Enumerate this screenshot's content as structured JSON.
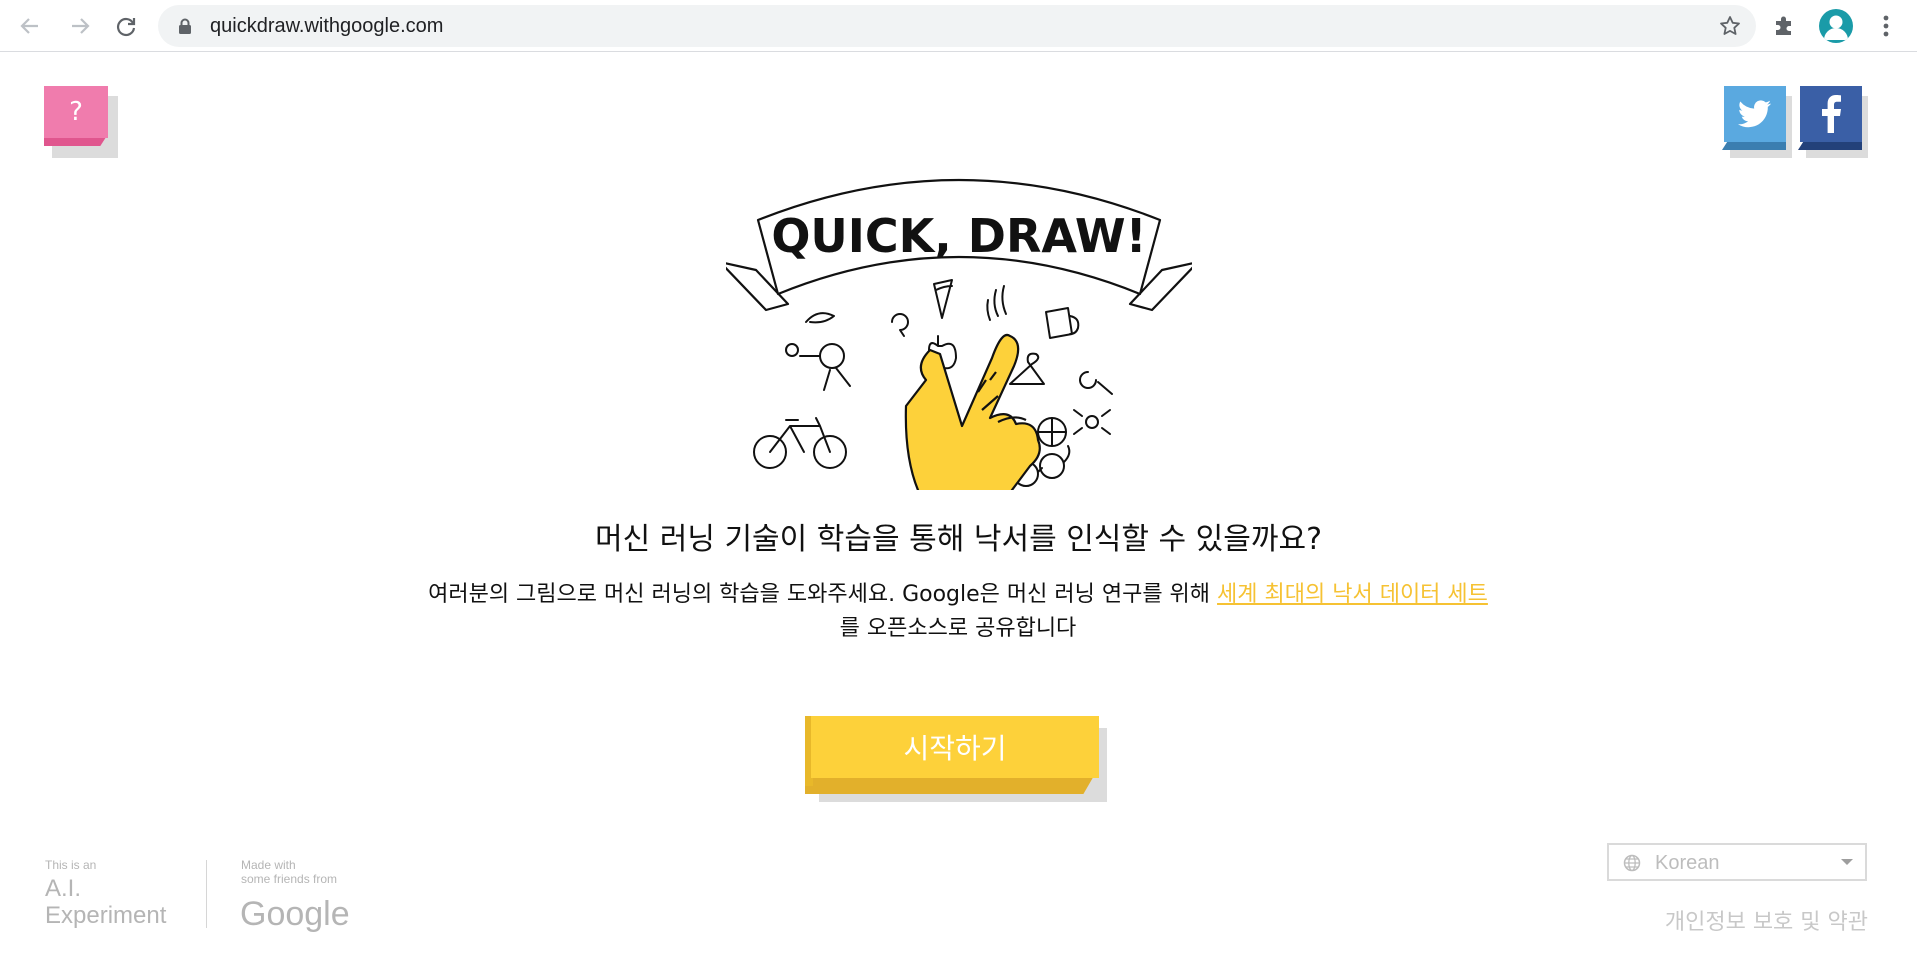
{
  "browser": {
    "url": "quickdraw.withgoogle.com"
  },
  "header": {
    "help_label": "?"
  },
  "hero": {
    "logo_text": "QUICK, DRAW!"
  },
  "main": {
    "headline": "머신 러닝 기술이 학습을 통해 낙서를 인식할 수 있을까요?",
    "subtext_before": "여러분의 그림으로 머신 러닝의 학습을 도와주세요. Google은 머신 러닝 연구를 위해 ",
    "dataset_link": "세계 최대의 낙서 데이터 세트",
    "subtext_after": "를 오픈소스로 공유합니다",
    "start_label": "시작하기"
  },
  "footer": {
    "ai_small": "This is an",
    "ai_line1": "A.I.",
    "ai_line2": "Experiment",
    "made_with_line1": "Made with",
    "made_with_line2": "some friends from",
    "google_text": "Google",
    "language": "Korean",
    "privacy": "개인정보 보호 및 약관"
  },
  "colors": {
    "accent_yellow": "#fdd13a",
    "help_pink": "#f07cad",
    "twitter_blue": "#5aa9e0",
    "facebook_blue": "#3a5fa6",
    "link_yellow": "#f6c233"
  },
  "icons": {
    "back": "arrow-left-icon",
    "forward": "arrow-right-icon",
    "reload": "reload-icon",
    "lock": "lock-icon",
    "bookmark": "star-icon",
    "extensions": "puzzle-icon",
    "profile": "avatar-icon",
    "menu": "kebab-menu-icon",
    "twitter": "twitter-icon",
    "facebook": "facebook-icon",
    "language": "globe-icon"
  }
}
